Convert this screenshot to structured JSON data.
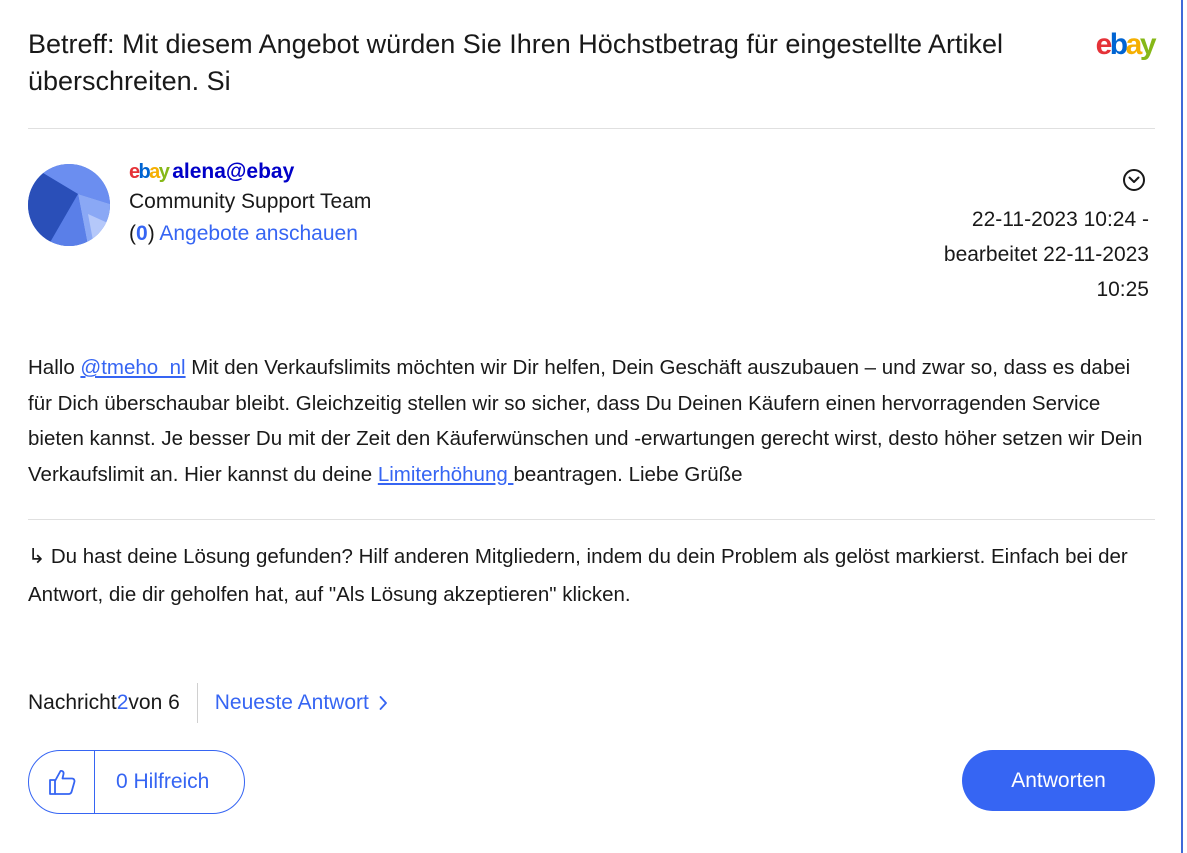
{
  "post": {
    "subject": "Betreff: Mit diesem Angebot würden Sie Ihren Höchstbetrag für eingestellte Artikel überschreiten. Si",
    "brand_logo": "ebay",
    "author": {
      "logo_text": "ebay",
      "name": "alena@ebay",
      "rank": "Community Support Team",
      "offers_count": "0",
      "offers_open": "(",
      "offers_close": ")",
      "offers_link": "Angebote anschauen"
    },
    "timestamp": {
      "line1": "22-11-2023 10:24 -",
      "line2": "bearbeitet 22-11-2023",
      "line3": "10:25"
    },
    "body": {
      "greeting": "Hallo ",
      "mention": "@tmeho_nl",
      "text1": " Mit den Verkaufslimits möchten wir Dir helfen, Dein Geschäft auszubauen – und zwar so, dass es dabei für Dich überschaubar bleibt. Gleichzeitig stellen wir so sicher, dass Du Deinen Käufern einen hervorragenden Service bieten kannst. Je besser Du mit der Zeit den Käuferwünschen und -erwartungen gerecht wirst, desto höher setzen wir Dein Verkaufslimit an. Hier kannst du deine ",
      "link": "Limiterhöhung ",
      "text2": " beantragen. Liebe Grüße"
    },
    "solution_note": "↳ Du hast deine Lösung gefunden? Hilf anderen Mitgliedern, indem du dein Problem als gelöst markierst. Einfach bei der Antwort, die dir geholfen hat, auf \"Als Lösung akzeptieren\" klicken."
  },
  "pager": {
    "prefix": "Nachricht ",
    "current": "2",
    "of": " von 6",
    "latest_link": "Neueste Antwort"
  },
  "actions": {
    "kudos_label": "0 Hilfreich",
    "reply_label": "Antworten"
  },
  "icons": {
    "menu": "chevron-down-circle-icon",
    "pager_next": "chevron-right-icon",
    "kudos": "thumbs-up-icon"
  },
  "colors": {
    "accent": "#3665f3",
    "author": "#0000c8",
    "ebay_e": "#e53238",
    "ebay_b": "#0064d2",
    "ebay_a": "#f5af02",
    "ebay_y": "#86b817"
  }
}
